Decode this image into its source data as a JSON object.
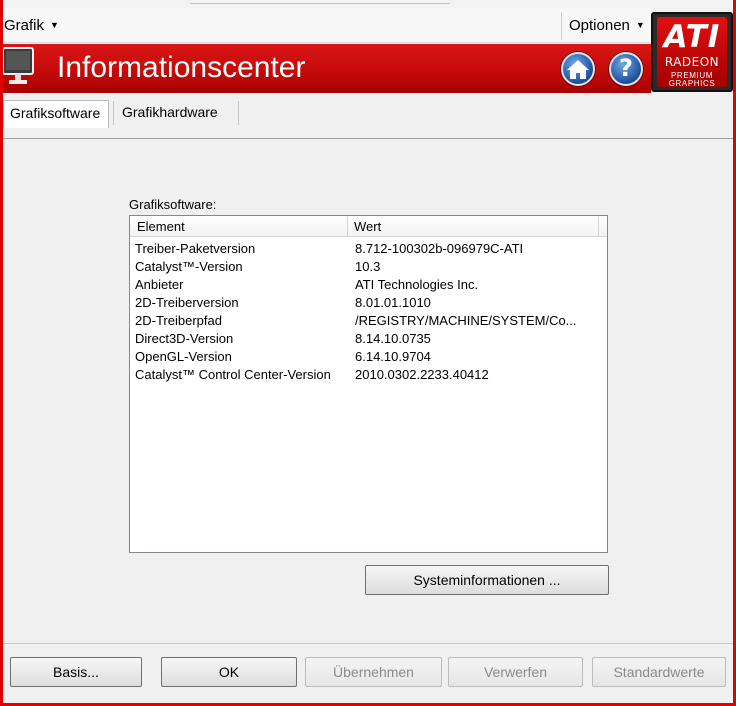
{
  "menubar": {
    "grafik_label": "Grafik",
    "optionen_label": "Optionen"
  },
  "logo": {
    "brand": "ATI",
    "product": "RADEON",
    "tagline_1": "PREMIUM",
    "tagline_2": "GRAPHICS"
  },
  "banner": {
    "title": "Informationscenter",
    "home_icon": "home-icon",
    "help_icon": "help-icon",
    "help_glyph": "?"
  },
  "tabs": [
    {
      "label": "Grafiksoftware",
      "active": true
    },
    {
      "label": "Grafikhardware",
      "active": false
    }
  ],
  "software": {
    "section_label": "Grafiksoftware:",
    "columns": [
      "Element",
      "Wert"
    ],
    "rows": [
      {
        "element": "Treiber-Paketversion",
        "value": "8.712-100302b-096979C-ATI"
      },
      {
        "element": "Catalyst™-Version",
        "value": "10.3"
      },
      {
        "element": "Anbieter",
        "value": "ATI Technologies Inc."
      },
      {
        "element": "2D-Treiberversion",
        "value": "8.01.01.1010"
      },
      {
        "element": "2D-Treiberpfad",
        "value": "/REGISTRY/MACHINE/SYSTEM/Co..."
      },
      {
        "element": "Direct3D-Version",
        "value": "8.14.10.0735"
      },
      {
        "element": "OpenGL-Version",
        "value": "6.14.10.9704"
      },
      {
        "element": "Catalyst™ Control Center-Version",
        "value": "2010.0302.2233.40412"
      }
    ],
    "system_info_button": "Systeminformationen ..."
  },
  "footer": {
    "basis": "Basis...",
    "ok": "OK",
    "apply": "Übernehmen",
    "discard": "Verwerfen",
    "defaults": "Standardwerte"
  },
  "colors": {
    "accent_red": "#c60a0a",
    "frame_red": "#e00000"
  }
}
